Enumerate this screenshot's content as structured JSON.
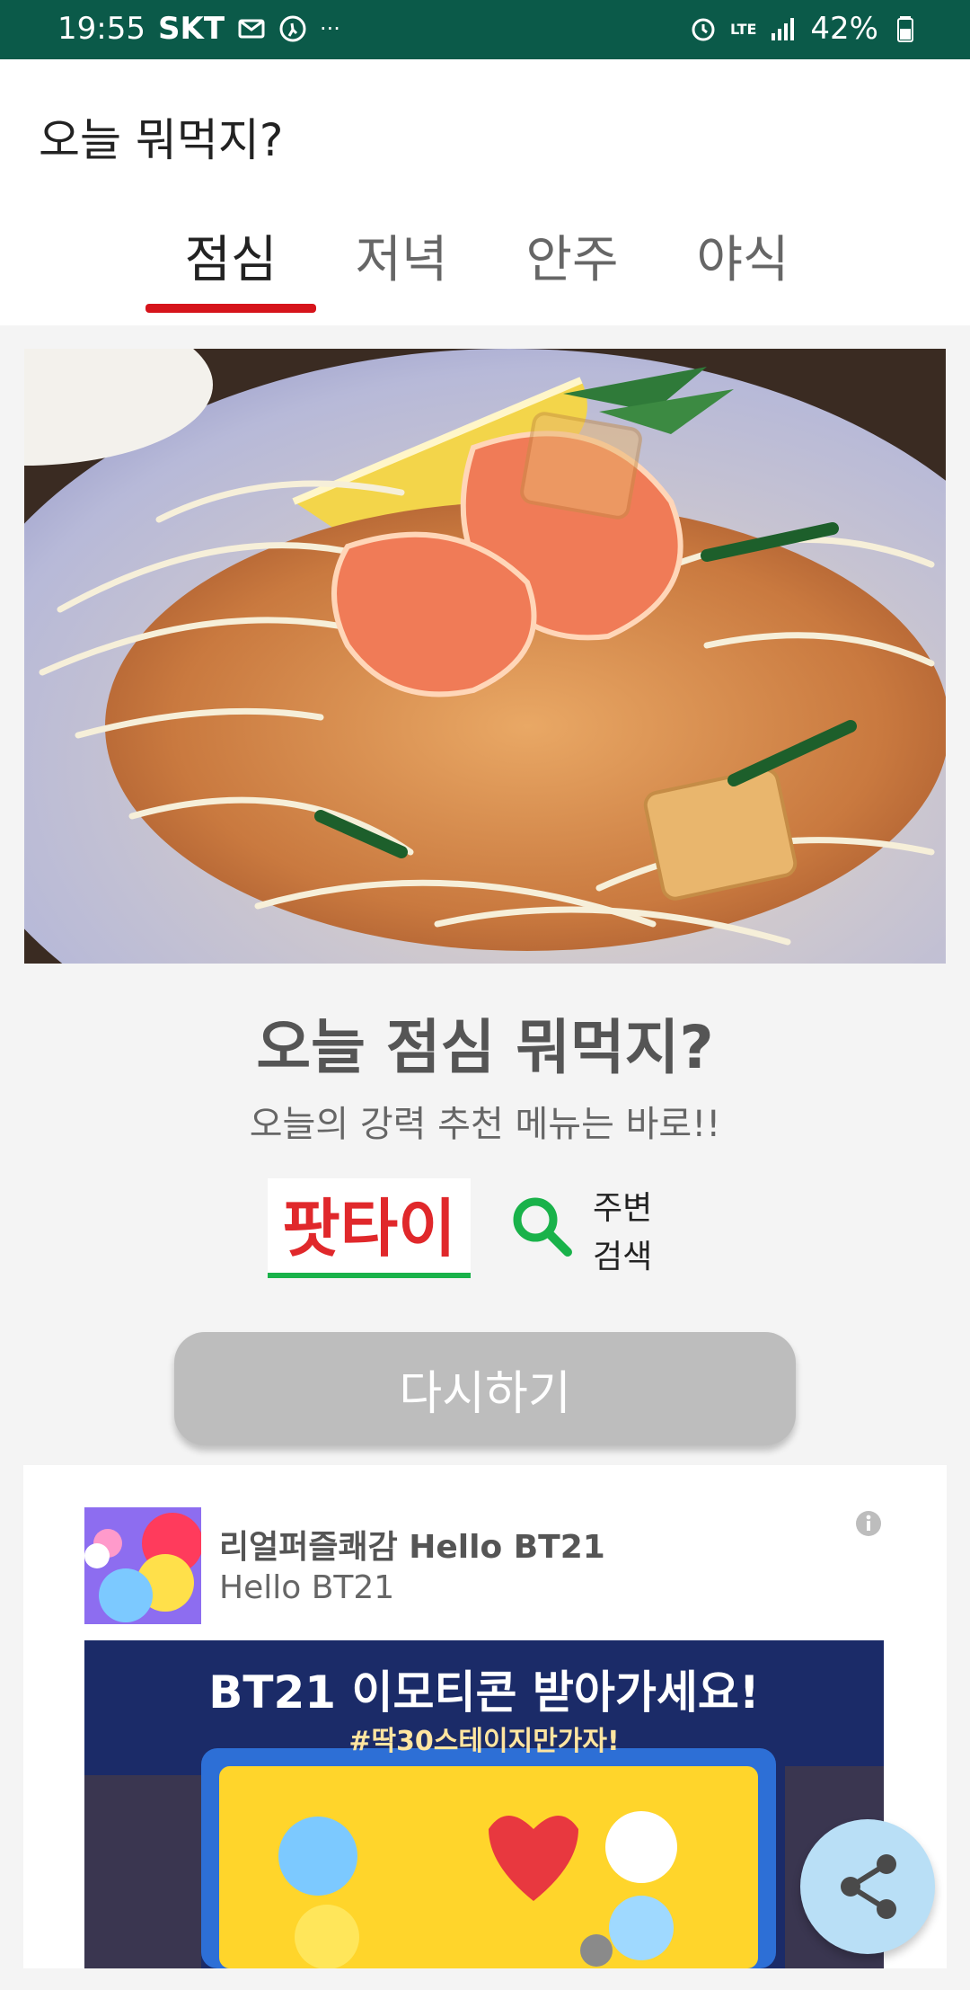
{
  "status_bar": {
    "time": "19:55",
    "carrier": "SKT",
    "more": "···",
    "network": "LTE",
    "battery": "42%"
  },
  "app": {
    "title": "오늘 뭐먹지?"
  },
  "tabs": [
    {
      "label": "점심",
      "active": true
    },
    {
      "label": "저녁",
      "active": false
    },
    {
      "label": "안주",
      "active": false
    },
    {
      "label": "야식",
      "active": false
    }
  ],
  "main": {
    "title": "오늘 점심 뭐먹지?",
    "subtitle": "오늘의 강력 추천 메뉴는 바로!!",
    "result": "팟타이",
    "nearby_line1": "주변",
    "nearby_line2": "검색",
    "retry_label": "다시하기"
  },
  "ad": {
    "title": "리얼퍼즐쾌감 Hello BT21",
    "subtitle": "Hello BT21",
    "banner_title": "BT21 이모티콘 받아가세요!",
    "banner_subtitle": "#딱30스테이지만가자!"
  },
  "colors": {
    "statusbar": "#0b5a49",
    "accent_red": "#d6141b",
    "result_red": "#e0282b",
    "green": "#19b24a",
    "fab": "#b9dff6"
  },
  "icons": {
    "search": "search-icon",
    "info": "info-icon",
    "share": "share-icon"
  }
}
